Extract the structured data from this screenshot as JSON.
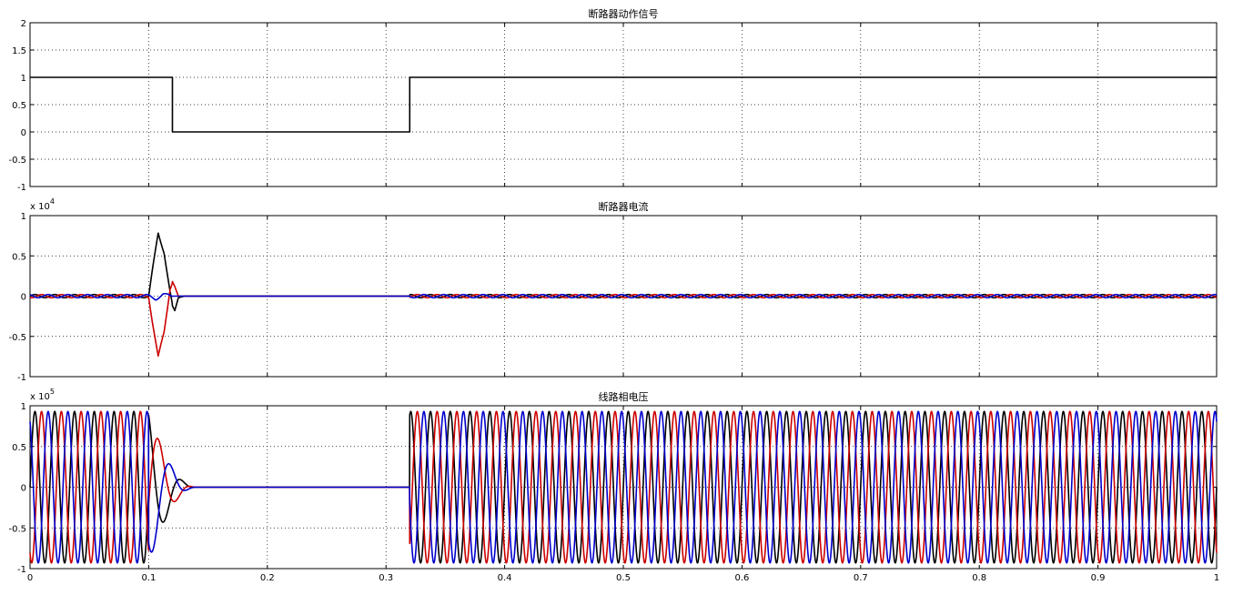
{
  "chart_data": [
    {
      "type": "line",
      "title": "断路器动作信号",
      "xlim": [
        0,
        1
      ],
      "ylim": [
        -1,
        2
      ],
      "yticks": [
        -1,
        -0.5,
        0,
        0.5,
        1,
        1.5,
        2
      ],
      "ytick_labels": [
        "-1",
        "-0.5",
        "0",
        "0.5",
        "1",
        "1.5",
        "2"
      ],
      "exponent": "",
      "grid": true,
      "series": [
        {
          "color": "#000000",
          "x": [
            0,
            0.12,
            0.12,
            0.32,
            0.32,
            1
          ],
          "y": [
            1,
            1,
            0,
            0,
            1,
            1
          ]
        }
      ]
    },
    {
      "type": "line",
      "title": "断路器电流",
      "xlim": [
        0,
        1
      ],
      "ylim": [
        -1,
        1
      ],
      "yticks": [
        -1,
        -0.5,
        0,
        0.5,
        1
      ],
      "ytick_labels": [
        "-1",
        "-0.5",
        "0",
        "0.5",
        "1"
      ],
      "exponent": "x 10^4",
      "exponent_base": "x 10",
      "exponent_power": "4",
      "grid": true,
      "series": [
        {
          "color": "#000000",
          "x": [
            0,
            0.1,
            0.103,
            0.108,
            0.113,
            0.118,
            0.12,
            0.122,
            0.125,
            0.13,
            1
          ],
          "y": [
            0,
            0,
            0.3,
            0.78,
            0.55,
            0.05,
            -0.12,
            -0.18,
            -0.02,
            0,
            0
          ]
        },
        {
          "color": "#cc0000",
          "x": [
            0,
            0.1,
            0.103,
            0.108,
            0.113,
            0.118,
            0.12,
            0.122,
            0.125,
            0.13,
            1
          ],
          "y": [
            0,
            0,
            -0.3,
            -0.76,
            -0.45,
            0.1,
            0.18,
            0.12,
            0,
            0,
            0
          ]
        },
        {
          "color": "#0000cc",
          "x": [
            0,
            0.1,
            0.106,
            0.112,
            0.118,
            1
          ],
          "y": [
            0,
            0,
            -0.03,
            0.02,
            0,
            0
          ]
        }
      ],
      "ripple": {
        "amplitude": 0.02,
        "frequency_hz": 60,
        "until": 0.12,
        "from": 0.32
      }
    },
    {
      "type": "line",
      "title": "线路相电压",
      "xlim": [
        0,
        1
      ],
      "ylim": [
        -1,
        1
      ],
      "yticks": [
        -1,
        -0.5,
        0,
        0.5,
        1
      ],
      "ytick_labels": [
        "-1",
        "-0.5",
        "0",
        "0.5",
        "1"
      ],
      "xticks": [
        0,
        0.1,
        0.2,
        0.3,
        0.4,
        0.5,
        0.6,
        0.7,
        0.8,
        0.9,
        1
      ],
      "xtick_labels": [
        "0",
        "0.1",
        "0.2",
        "0.3",
        "0.4",
        "0.5",
        "0.6",
        "0.7",
        "0.8",
        "0.9",
        "1"
      ],
      "exponent": "x 10^5",
      "exponent_base": "x 10",
      "exponent_power": "5",
      "grid": true,
      "three_phase": {
        "amplitude": 0.93,
        "frequency_hz": 60,
        "open_at": 0.1,
        "decay_until": 0.14,
        "reclose_at": 0.32,
        "colors": [
          "#000000",
          "#cc0000",
          "#0000cc"
        ]
      }
    }
  ]
}
